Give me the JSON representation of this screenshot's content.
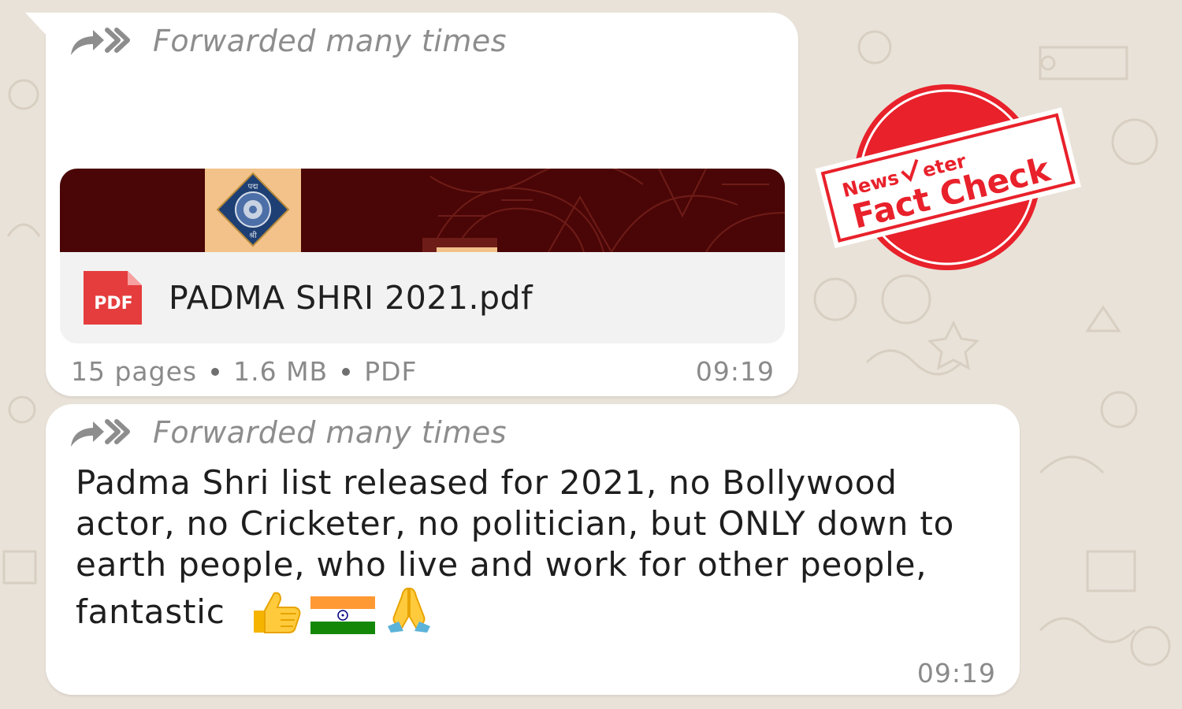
{
  "messages": [
    {
      "forwarded_label": "Forwarded many times",
      "document": {
        "file_name": "PADMA SHRI 2021.pdf",
        "icon_label": "PDF",
        "pages": "15 pages",
        "size": "1.6 MB",
        "type": "PDF"
      },
      "time": "09:19"
    },
    {
      "forwarded_label": "Forwarded many times",
      "text": "Padma Shri list released for 2021, no Bollywood actor, no Cricketer, no politician, but ONLY down to earth people, who live and work for other people, fantastic",
      "emojis": [
        "thumbs-up",
        "india-flag",
        "folded-hands"
      ],
      "time": "09:19"
    }
  ],
  "stamp": {
    "brand_left": "News",
    "brand_right": "eter",
    "label": "Fact Check",
    "color": "#e8212b"
  },
  "thumbnail": {
    "emblem_top": "पद्म",
    "emblem_bottom": "श्री"
  },
  "colors": {
    "wallpaper": "#e9e2d8",
    "bubble": "#ffffff",
    "thumbnail_bg": "#4a0606",
    "pdf_red": "#e53d3d"
  }
}
